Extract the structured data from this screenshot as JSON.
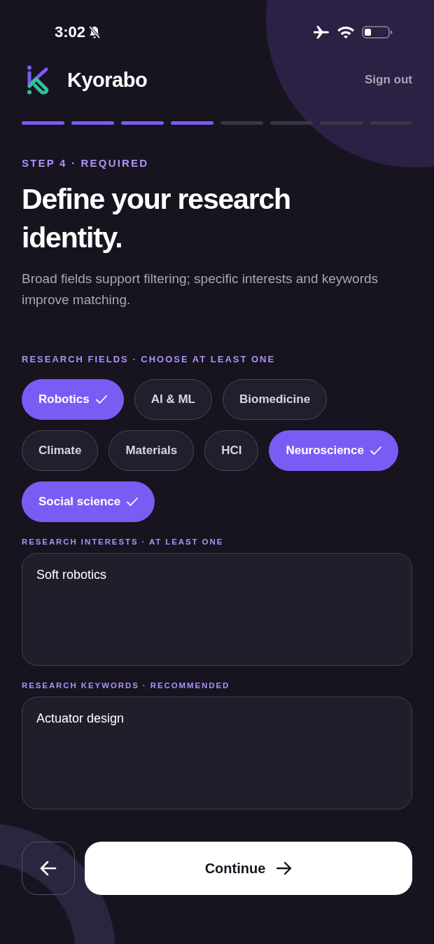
{
  "status_bar": {
    "time": "3:02"
  },
  "header": {
    "brand": "Kyorabo",
    "sign_out": "Sign out"
  },
  "progress": [
    {
      "done": true
    },
    {
      "done": true
    },
    {
      "done": true
    },
    {
      "done": true
    },
    {
      "done": false
    },
    {
      "done": false
    },
    {
      "done": false
    },
    {
      "done": false
    }
  ],
  "step_label": "STEP 4 · REQUIRED",
  "title": "Define your research identity.",
  "subtitle": "Broad fields support filtering; specific interests and keywords improve matching.",
  "fields": {
    "label": "RESEARCH FIELDS · CHOOSE AT LEAST ONE",
    "chips": [
      {
        "label": "Robotics",
        "selected": true
      },
      {
        "label": "AI & ML",
        "selected": false
      },
      {
        "label": "Biomedicine",
        "selected": false
      },
      {
        "label": "Climate",
        "selected": false
      },
      {
        "label": "Materials",
        "selected": false
      },
      {
        "label": "HCI",
        "selected": false
      },
      {
        "label": "Neuroscience",
        "selected": true
      },
      {
        "label": "Social science",
        "selected": true
      }
    ]
  },
  "interests": {
    "label": "RESEARCH INTERESTS · AT LEAST ONE",
    "value": "Soft robotics"
  },
  "keywords": {
    "label": "RESEARCH KEYWORDS · RECOMMENDED",
    "value": "Actuator design"
  },
  "continue_button": "Continue"
}
